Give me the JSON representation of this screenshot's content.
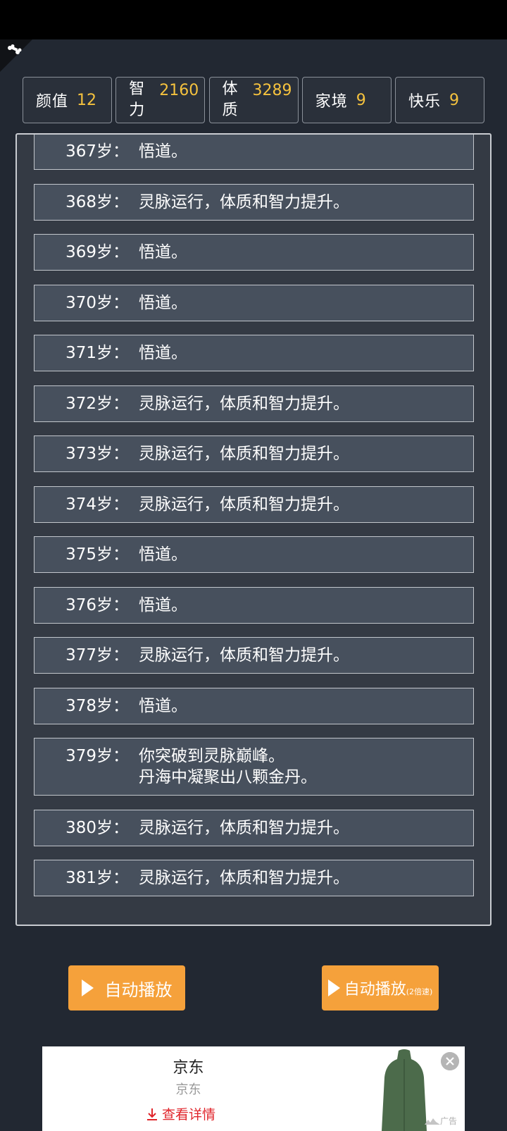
{
  "stats": [
    {
      "label": "颜值",
      "value": "12"
    },
    {
      "label": "智力",
      "value": "2160"
    },
    {
      "label": "体质",
      "value": "3289"
    },
    {
      "label": "家境",
      "value": "9"
    },
    {
      "label": "快乐",
      "value": "9"
    }
  ],
  "log": [
    {
      "age": "367岁：",
      "text": "悟道。"
    },
    {
      "age": "368岁：",
      "text": "灵脉运行，体质和智力提升。"
    },
    {
      "age": "369岁：",
      "text": "悟道。"
    },
    {
      "age": "370岁：",
      "text": "悟道。"
    },
    {
      "age": "371岁：",
      "text": "悟道。"
    },
    {
      "age": "372岁：",
      "text": "灵脉运行，体质和智力提升。"
    },
    {
      "age": "373岁：",
      "text": "灵脉运行，体质和智力提升。"
    },
    {
      "age": "374岁：",
      "text": "灵脉运行，体质和智力提升。"
    },
    {
      "age": "375岁：",
      "text": "悟道。"
    },
    {
      "age": "376岁：",
      "text": "悟道。"
    },
    {
      "age": "377岁：",
      "text": "灵脉运行，体质和智力提升。"
    },
    {
      "age": "378岁：",
      "text": "悟道。"
    },
    {
      "age": "379岁：",
      "text": "你突破到灵脉巅峰。\n丹海中凝聚出八颗金丹。"
    },
    {
      "age": "380岁：",
      "text": "灵脉运行，体质和智力提升。"
    },
    {
      "age": "381岁：",
      "text": "灵脉运行，体质和智力提升。"
    }
  ],
  "buttons": {
    "autoplay_label": "自动播放",
    "autoplay_fast_label": "自动播放",
    "autoplay_fast_suffix": "(2倍速)"
  },
  "ad": {
    "title": "京东",
    "subtitle": "京东",
    "cta": "查看详情",
    "tag": "广告",
    "close_icon": "close-circle-icon",
    "cta_icon": "download-arrow-icon"
  },
  "colors": {
    "background": "#222832",
    "stat_value": "#f5c23e",
    "button": "#f5a13b",
    "log_item": "#47505d",
    "ad_cta": "#e0252b"
  }
}
